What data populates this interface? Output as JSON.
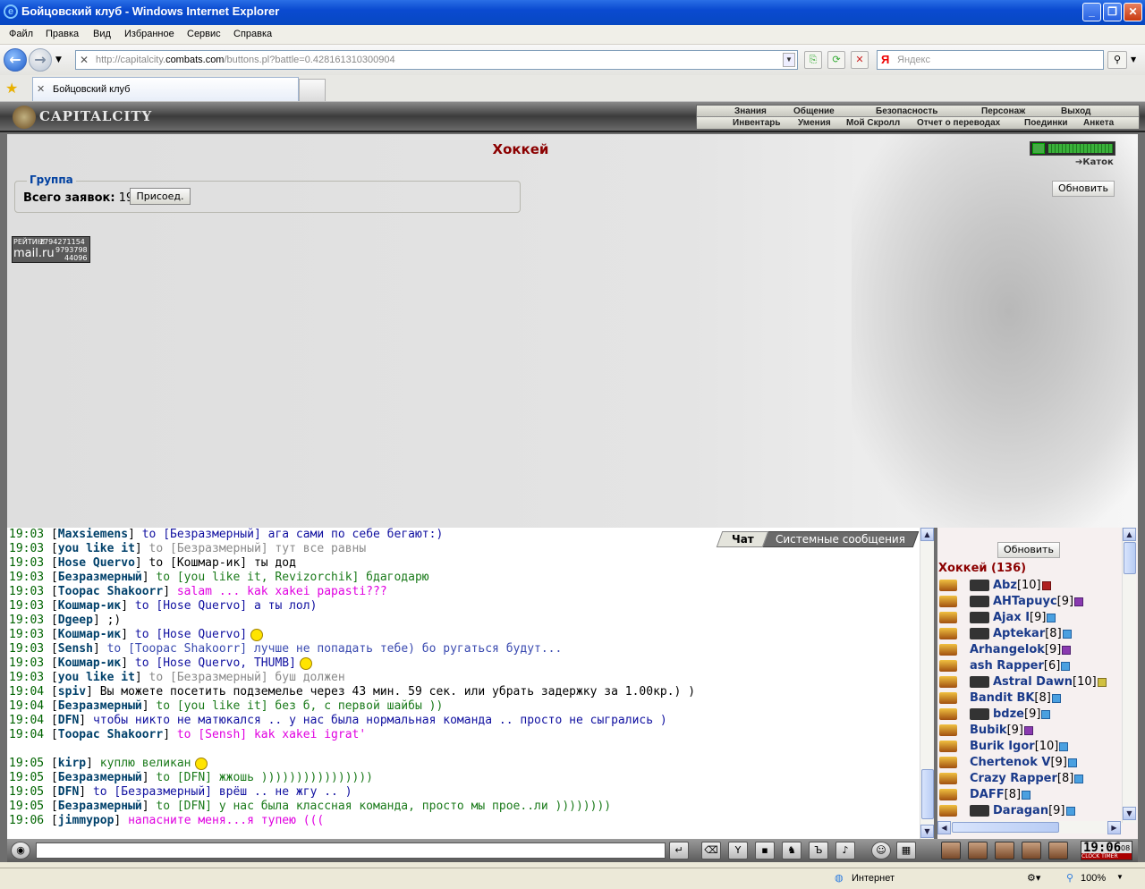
{
  "window": {
    "title": "Бойцовский клуб - Windows Internet Explorer"
  },
  "menu": [
    "Файл",
    "Правка",
    "Вид",
    "Избранное",
    "Сервис",
    "Справка"
  ],
  "address": {
    "prefix": "http://capitalcity.",
    "domain": "combats.com",
    "suffix": "/buttons.pl?battle=0.428161310300904"
  },
  "search": {
    "placeholder": "Яндекс"
  },
  "tab": {
    "label": "Бойцовский клуб"
  },
  "game": {
    "logo": "CAPITALCITY",
    "nav_row1": [
      "Знания",
      "Общение",
      "Безопасность",
      "Персонаж",
      "Выход"
    ],
    "nav_row2": [
      "Инвентарь",
      "Умения",
      "Мой Скролл",
      "Отчет о переводах",
      "Поединки",
      "Анкета"
    ],
    "page_title": "Хоккей",
    "group_legend": "Группа",
    "requests_label": "Всего заявок:",
    "requests_count": "19",
    "join_button": "Присоед.",
    "location_link": "Каток",
    "refresh_button": "Обновить",
    "counter": {
      "label": "РЕЙТИНГ",
      "brand": "mail.ru",
      "n1": "2794271154",
      "n2": "9793798",
      "n3": "44096"
    },
    "hp_fraction": 1.0
  },
  "chat": {
    "tab_chat": "Чат",
    "tab_system": "Системные сообщения",
    "lines": [
      {
        "time": "19:03",
        "nick": "Maxsiemens",
        "text": "to [Безразмерный] ага сами по себе бегают:)",
        "c": "c5"
      },
      {
        "time": "19:03",
        "nick": "you like it",
        "text": "to [Безразмерный] тут все равны",
        "c": "c2"
      },
      {
        "time": "19:03",
        "nick": "Hose Quervo",
        "text": "to [Кошмар-ик] ты дод",
        "c": "c4"
      },
      {
        "time": "19:03",
        "nick": "Безразмерный",
        "text": "to [you like it, Revizorchik] бдагодарю",
        "c": "c1"
      },
      {
        "time": "19:03",
        "nick": "Toopac Shakoorr",
        "text": "salam ... kak xakei papasti???",
        "c": "c3"
      },
      {
        "time": "19:03",
        "nick": "Кошмар-ик",
        "text": "to [Hose Quervo] а ты лол)",
        "c": "c5"
      },
      {
        "time": "19:03",
        "nick": "Dgeep",
        "text": ";)",
        "c": "c4"
      },
      {
        "time": "19:03",
        "nick": "Кошмар-ик",
        "text": "to [Hose Quervo]",
        "c": "c5",
        "smile": true
      },
      {
        "time": "19:03",
        "nick": "Sensh",
        "text": "to [Toopac Shakoorr] лучше не попадать тебе) бо ругаться будут...",
        "c": "c6"
      },
      {
        "time": "19:03",
        "nick": "Кошмар-ик",
        "text": "to [Hose Quervo, THUMB]",
        "c": "c5",
        "smile": true
      },
      {
        "time": "19:03",
        "nick": "you like it",
        "text": "to [Безразмерный] буш должен",
        "c": "c2"
      },
      {
        "time": "19:04",
        "nick": "spiv",
        "text": "Вы можете посетить подземелье через 43 мин. 59 сек. или убрать задержку за 1.00кр.) )",
        "c": "c4"
      },
      {
        "time": "19:04",
        "nick": "Безразмерный",
        "text": "to [you like it] без б, с первой шайбы ))",
        "c": "c1"
      },
      {
        "time": "19:04",
        "nick": "DFN",
        "text": "чтобы никто не матюкался .. у нас была нормальная команда .. просто не сыгрались )",
        "c": "c5"
      },
      {
        "time": "19:04",
        "nick": "Toopac Shakoorr",
        "text": "to [Sensh] kak xakei igrat'",
        "c": "c3"
      },
      {
        "time": "",
        "nick": "",
        "text": "",
        "c": "c4"
      },
      {
        "time": "19:05",
        "nick": "kirp",
        "text": "куплю великан",
        "c": "c1",
        "smile": true
      },
      {
        "time": "19:05",
        "nick": "Безразмерный",
        "text": "to [DFN] жжошь ))))))))))))))))",
        "c": "c1"
      },
      {
        "time": "19:05",
        "nick": "DFN",
        "text": "to [Безразмерный] врёш .. не жгу .. )",
        "c": "c5"
      },
      {
        "time": "19:05",
        "nick": "Безразмерный",
        "text": "to [DFN] у нас была классная команда, просто мы прое..ли ))))))))",
        "c": "c1"
      },
      {
        "time": "19:06",
        "nick": "jimmypop",
        "text": "напасните меня...я тупею (((",
        "c": "c3"
      }
    ]
  },
  "users": {
    "refresh_button": "Обновить",
    "room": "Хоккей (136)",
    "list": [
      {
        "name": "Abz",
        "level": "[10]",
        "info": "r",
        "align": true
      },
      {
        "name": "AHTapuyc",
        "level": "[9]",
        "info": "v",
        "align": true
      },
      {
        "name": "Ajax I",
        "level": "[9]",
        "info": "b",
        "align": true
      },
      {
        "name": "Aptekar",
        "level": "[8]",
        "info": "b",
        "align": true
      },
      {
        "name": "Arhangelok",
        "level": "[9]",
        "info": "v",
        "align": false
      },
      {
        "name": "ash Rapper",
        "level": "[6]",
        "info": "b",
        "align": false
      },
      {
        "name": "Astral Dawn",
        "level": "[10]",
        "info": "y",
        "align": true
      },
      {
        "name": "Bandit BK",
        "level": "[8]",
        "info": "b",
        "align": false
      },
      {
        "name": "bdze",
        "level": "[9]",
        "info": "b",
        "align": true
      },
      {
        "name": "Bubik",
        "level": "[9]",
        "info": "v",
        "align": false
      },
      {
        "name": "Burik Igor",
        "level": "[10]",
        "info": "b",
        "align": false
      },
      {
        "name": "Chertenok V",
        "level": "[9]",
        "info": "b",
        "align": false
      },
      {
        "name": "Crazy Rapper",
        "level": "[8]",
        "info": "b",
        "align": false
      },
      {
        "name": "DAFF",
        "level": "[8]",
        "info": "b",
        "align": false
      },
      {
        "name": "Daragan",
        "level": "[9]",
        "info": "b",
        "align": true
      }
    ]
  },
  "clock": {
    "time": "19:06",
    "sec": "08",
    "labels": "CLOCK TIMER"
  },
  "status": {
    "zone": "Интернет",
    "zoom": "100%"
  },
  "colors": {
    "title_blue": "#0748c2",
    "game_red": "#8b0000",
    "chat_time": "#006400"
  }
}
